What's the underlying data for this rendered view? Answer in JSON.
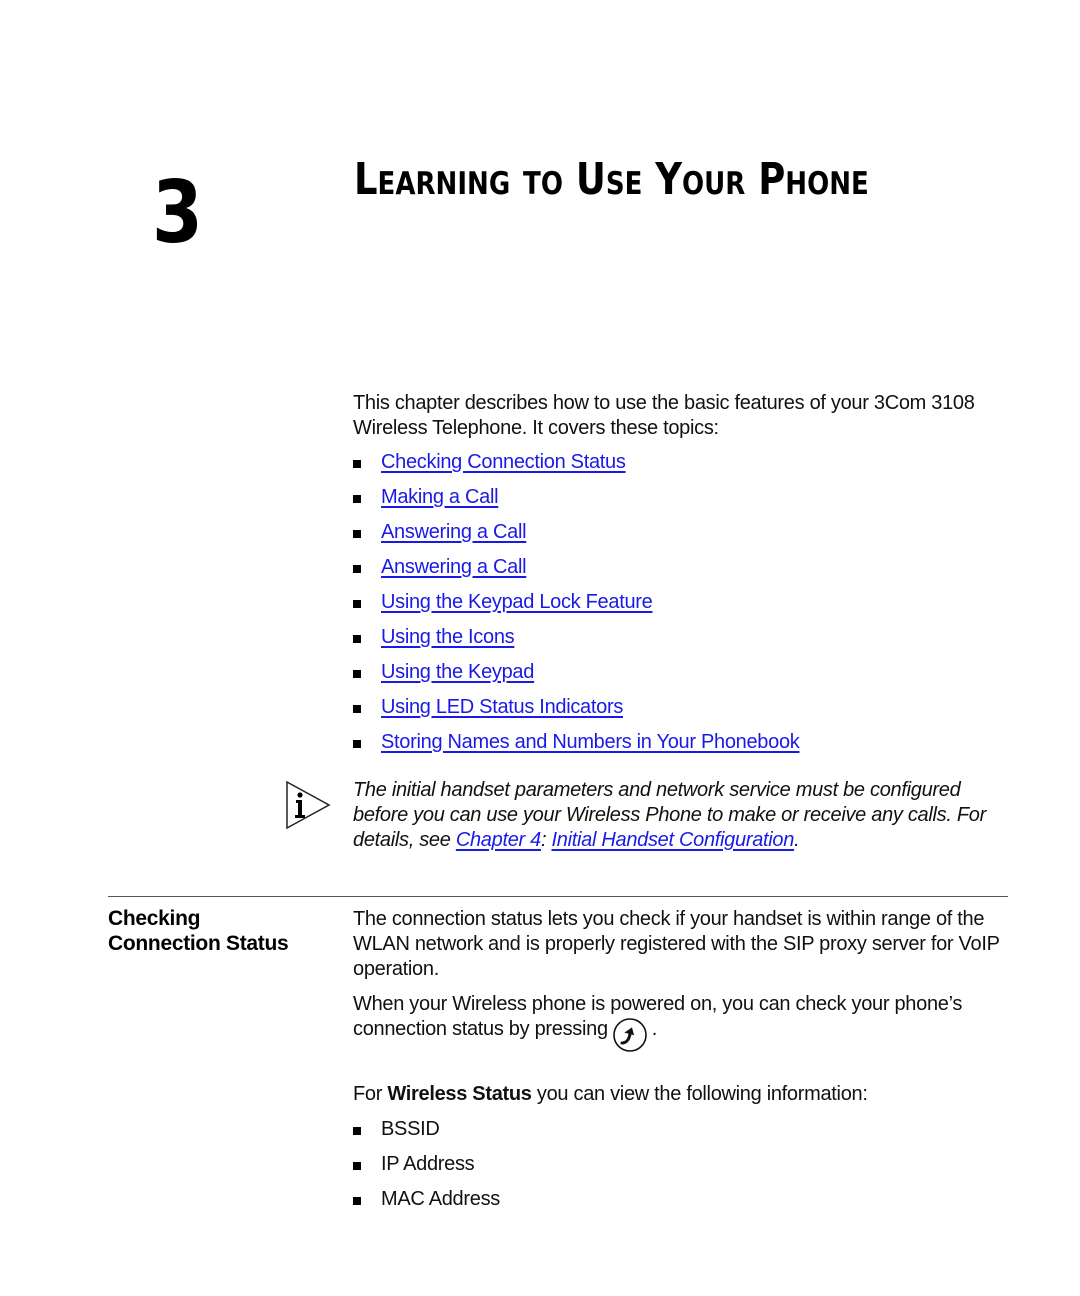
{
  "chapter": {
    "number": "3",
    "title": "Learning to Use Your Phone"
  },
  "intro": {
    "text": "This chapter describes how to use the basic features of your 3Com 3108 Wireless Telephone. It covers these topics:"
  },
  "topics": [
    {
      "label": "Checking Connection Status"
    },
    {
      "label": "Making a Call"
    },
    {
      "label": "Answering a Call"
    },
    {
      "label": "Answering a Call"
    },
    {
      "label": "Using the Keypad Lock Feature"
    },
    {
      "label": "Using the Icons"
    },
    {
      "label": "Using the Keypad"
    },
    {
      "label": "Using LED Status Indicators"
    },
    {
      "label": "Storing Names and Numbers in Your Phonebook"
    }
  ],
  "note": {
    "icon": "info-note-icon",
    "text_before": "The initial handset parameters and network service must be configured before you can use your Wireless Phone to make or receive any calls. For details, see ",
    "link_chapter": "Chapter 4",
    "separator": ": ",
    "link_title": "Initial Handset Configuration",
    "text_after": "."
  },
  "section": {
    "heading_line1": "Checking",
    "heading_line2": "Connection Status",
    "paragraph1": "The connection status lets you check if your handset is within range of the WLAN network and is properly registered with the SIP proxy server for VoIP operation.",
    "paragraph2_before": "When your Wireless phone is powered on, you can check your phone’s connection status by pressing",
    "paragraph2_icon": "status-key-icon",
    "paragraph2_after": ".",
    "paragraph3_prefix": "For ",
    "paragraph3_bold": "Wireless Status",
    "paragraph3_suffix": " you can view the following information:",
    "info_items": [
      {
        "label": "BSSID"
      },
      {
        "label": "IP Address"
      },
      {
        "label": "MAC Address"
      }
    ]
  },
  "colors": {
    "link": "#1a1ae6",
    "text": "#111111",
    "rule": "#555555"
  }
}
